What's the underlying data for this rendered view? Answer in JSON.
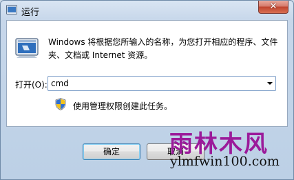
{
  "window": {
    "title": "运行",
    "close_symbol": "✕"
  },
  "icons": {
    "app": "run-icon",
    "large": "run-icon",
    "admin": "shield-icon",
    "dropdown": "chevron-down-icon"
  },
  "main": {
    "description": "Windows 将根据您所输入的名称，为您打开相应的程序、文件夹、文档或 Internet 资源。",
    "open_label": "打开(O):",
    "command_value": "cmd",
    "admin_note": "使用管理权限创建此任务。"
  },
  "buttons": {
    "ok": "确定",
    "cancel": "取消"
  },
  "watermark": {
    "brand": "雨林木风",
    "url": "ylmfwin100.com"
  },
  "colors": {
    "close_button": "#c0442f",
    "watermark_text": "#9b1a9a",
    "focus_border": "#3c7fb1"
  }
}
